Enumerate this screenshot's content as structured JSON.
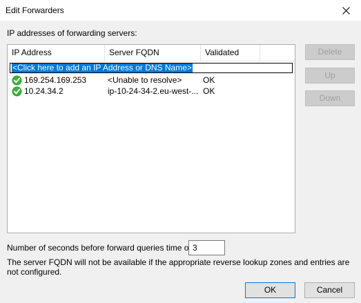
{
  "window": {
    "title": "Edit Forwarders",
    "close_glyph": "✕"
  },
  "servers": {
    "label": "IP addresses of forwarding servers:",
    "columns": [
      "IP Address",
      "Server FQDN",
      "Validated"
    ],
    "add_row_text": "<Click here to add an IP Address or DNS Name>",
    "rows": [
      {
        "ip": "169.254.169.253",
        "fqdn": "<Unable to resolve>",
        "validated": "OK",
        "icon": "green-check-icon"
      },
      {
        "ip": "10.24.34.2",
        "fqdn": "ip-10-24-34-2.eu-west-...",
        "validated": "OK",
        "icon": "green-check-icon"
      }
    ]
  },
  "side_buttons": {
    "delete": "Delete",
    "up": "Up",
    "down": "Down"
  },
  "timeout": {
    "label": "Number of seconds before forward queries time out:",
    "value": "3"
  },
  "note": "The server FQDN will not be available if the appropriate reverse lookup zones and entries are not configured.",
  "footer": {
    "ok": "OK",
    "cancel": "Cancel"
  },
  "colors": {
    "selection": "#0078d7",
    "check_green": "#2e9b2e"
  }
}
